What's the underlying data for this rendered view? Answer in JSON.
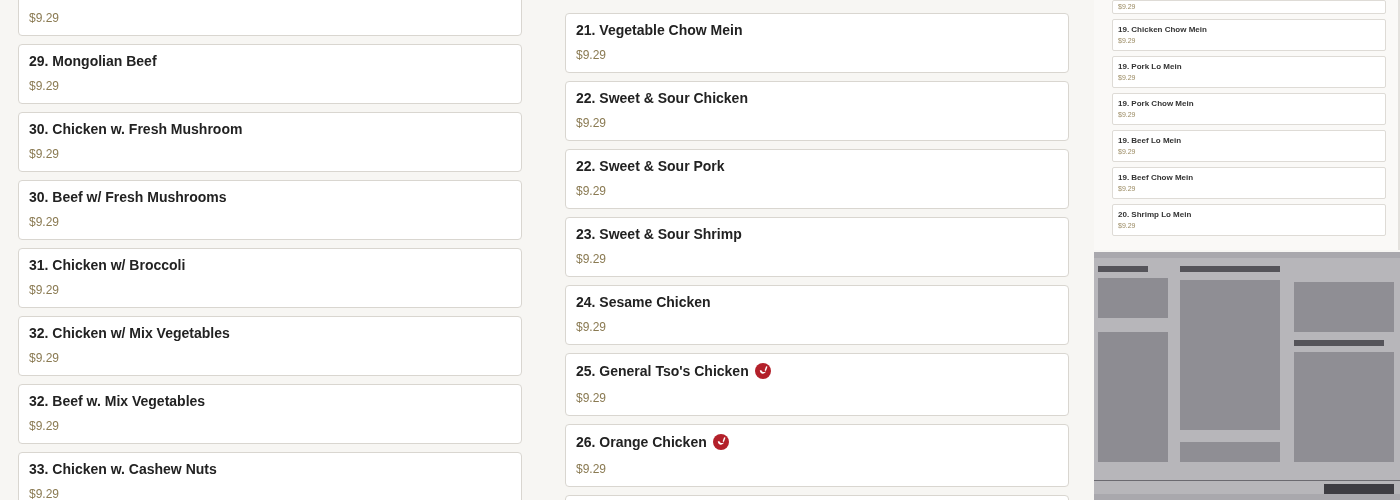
{
  "columns": [
    {
      "items": [
        {
          "price": "$9.29",
          "spicy": false
        },
        {
          "title": "29. Mongolian Beef",
          "price": "$9.29",
          "spicy": false
        },
        {
          "title": "30. Chicken w. Fresh Mushroom",
          "price": "$9.29",
          "spicy": false
        },
        {
          "title": "30. Beef w/ Fresh Mushrooms",
          "price": "$9.29",
          "spicy": false
        },
        {
          "title": "31. Chicken w/ Broccoli",
          "price": "$9.29",
          "spicy": false
        },
        {
          "title": "32. Chicken w/ Mix Vegetables",
          "price": "$9.29",
          "spicy": false
        },
        {
          "title": "32. Beef w. Mix Vegetables",
          "price": "$9.29",
          "spicy": false
        },
        {
          "title": "33. Chicken w. Cashew Nuts",
          "price": "$9.29",
          "spicy": false
        }
      ]
    },
    {
      "items": [
        {
          "title": "21. Vegetable Chow Mein",
          "price": "$9.29",
          "spicy": false
        },
        {
          "title": "22. Sweet & Sour Chicken",
          "price": "$9.29",
          "spicy": false
        },
        {
          "title": "22. Sweet & Sour Pork",
          "price": "$9.29",
          "spicy": false
        },
        {
          "title": "23. Sweet & Sour Shrimp",
          "price": "$9.29",
          "spicy": false
        },
        {
          "title": "24. Sesame Chicken",
          "price": "$9.29",
          "spicy": false
        },
        {
          "title": "25. General Tso's Chicken",
          "price": "$9.29",
          "spicy": true
        },
        {
          "title": "26. Orange Chicken",
          "price": "$9.29",
          "spicy": true
        },
        {
          "spicy": false
        }
      ]
    }
  ],
  "thumbnail": {
    "items": [
      {
        "price": "$9.29"
      },
      {
        "title": "19. Chicken Chow Mein",
        "price": "$9.29"
      },
      {
        "title": "19. Pork Lo Mein",
        "price": "$9.29"
      },
      {
        "title": "19. Pork Chow Mein",
        "price": "$9.29"
      },
      {
        "title": "19. Beef Lo Mein",
        "price": "$9.29"
      },
      {
        "title": "19. Beef Chow Mein",
        "price": "$9.29"
      },
      {
        "title": "20. Shrimp Lo Mein",
        "price": "$9.29"
      }
    ]
  }
}
